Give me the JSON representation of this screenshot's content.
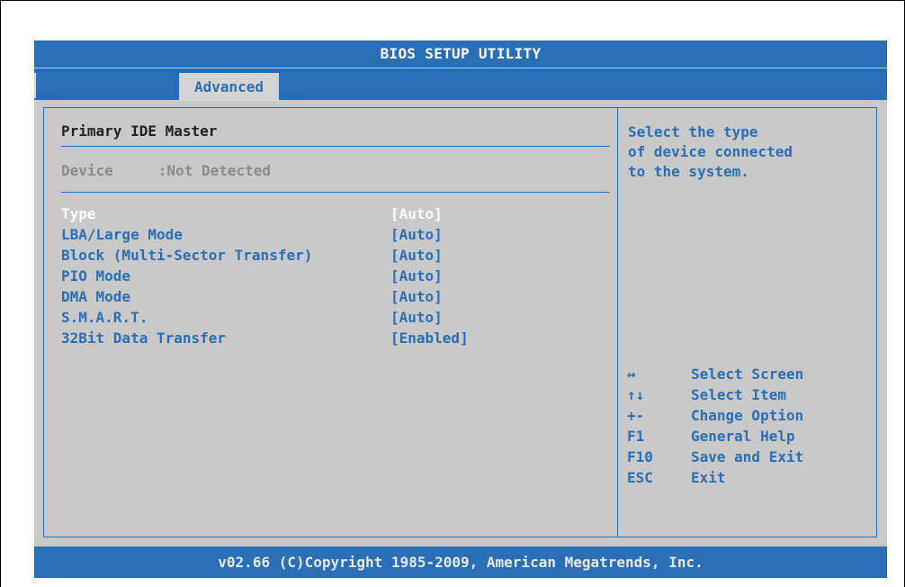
{
  "header": {
    "title": "BIOS SETUP UTILITY"
  },
  "menu": {
    "tabs": [
      {
        "label": "Advanced",
        "active": true
      }
    ]
  },
  "main": {
    "section_title": "Primary IDE Master",
    "device": {
      "label": "Device",
      "value": ":Not Detected"
    },
    "settings": [
      {
        "label": "Type",
        "value": "[Auto]",
        "selected": true
      },
      {
        "label": "LBA/Large Mode",
        "value": "[Auto]"
      },
      {
        "label": "Block (Multi-Sector Transfer)",
        "value": "[Auto]"
      },
      {
        "label": "PIO Mode",
        "value": "[Auto]"
      },
      {
        "label": "DMA Mode",
        "value": "[Auto]"
      },
      {
        "label": "S.M.A.R.T.",
        "value": "[Auto]"
      },
      {
        "label": "32Bit Data Transfer",
        "value": "[Enabled]"
      }
    ]
  },
  "help": {
    "lines": [
      "Select the type",
      "of device connected",
      "to the system."
    ],
    "keys": [
      {
        "key": "↔",
        "desc": "Select Screen"
      },
      {
        "key": "↑↓",
        "desc": "Select Item"
      },
      {
        "key": "+-",
        "desc": "Change Option"
      },
      {
        "key": "F1",
        "desc": "General Help"
      },
      {
        "key": "F10",
        "desc": "Save and Exit"
      },
      {
        "key": "ESC",
        "desc": "Exit"
      }
    ]
  },
  "footer": {
    "copyright": "v02.66 (C)Copyright 1985-2009, American Megatrends, Inc."
  },
  "colors": {
    "accent": "#2a6fb5",
    "panel_bg": "#c9c9c9",
    "selected_text": "#ffffff",
    "disabled_text": "#8a8a8a"
  }
}
